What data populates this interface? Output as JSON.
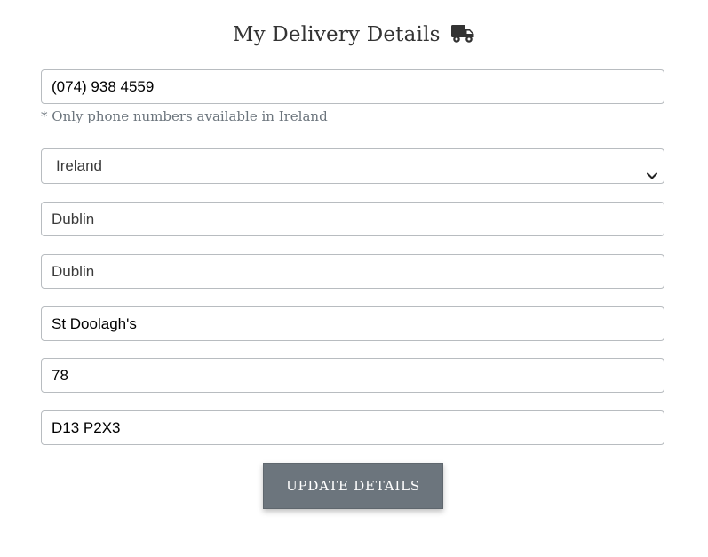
{
  "form": {
    "title": "My Delivery Details",
    "title_icon": "truck-icon",
    "phone": "(074) 938 4559",
    "phone_note": "* Only phone numbers available in Ireland",
    "country": "Ireland",
    "county": "Dublin",
    "city": "Dublin",
    "street": "St Doolagh's",
    "house_number": "78",
    "eircode": "D13 P2X3",
    "submit_label": "UPDATE DETAILS"
  },
  "colors": {
    "button_bg": "#6c757d",
    "helper_text": "#6c757d",
    "field_border": "#b8bcc0"
  }
}
